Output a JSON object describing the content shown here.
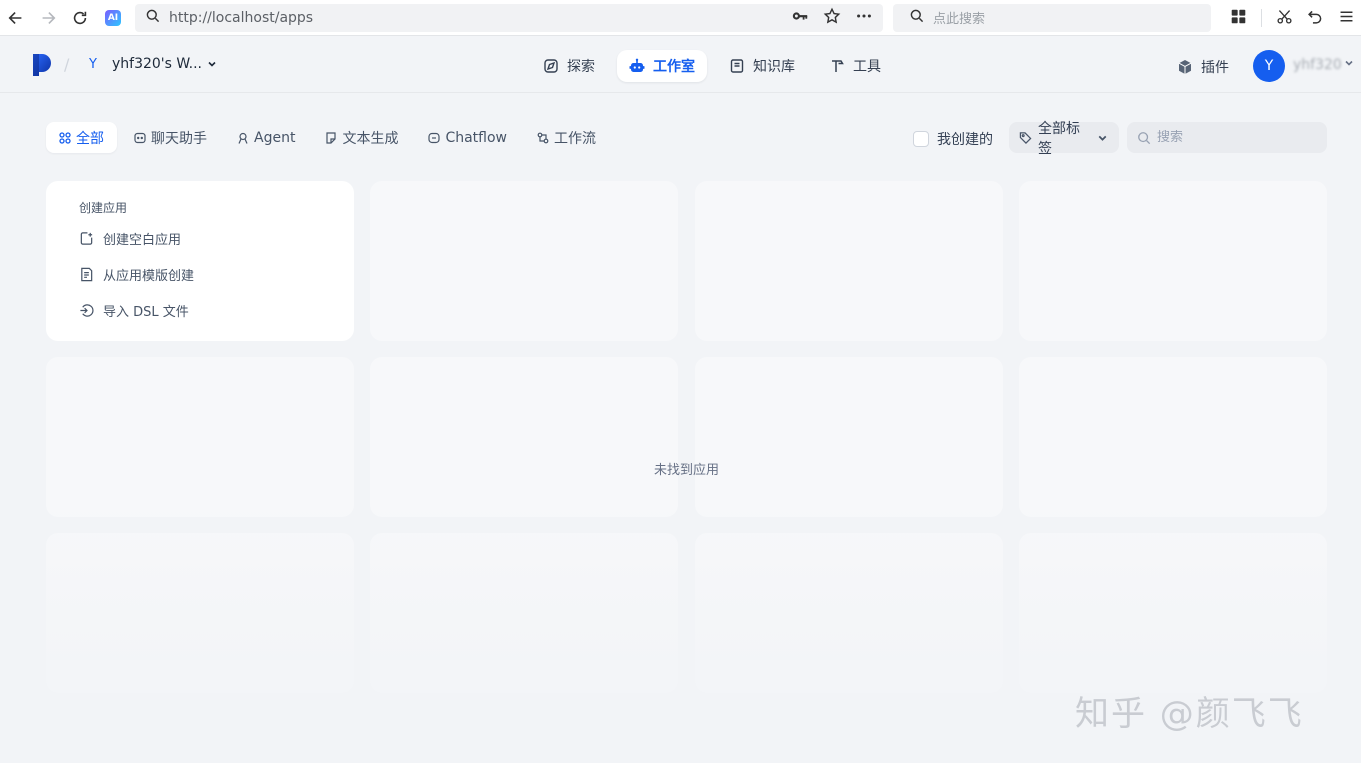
{
  "browser": {
    "url": "http://localhost/apps",
    "search_placeholder": "点此搜索",
    "ai_label": "AI"
  },
  "header": {
    "workspace_avatar": "Y",
    "workspace_name": "yhf320's W...",
    "nav": [
      {
        "label": "探索",
        "icon": "compass-icon",
        "active": false
      },
      {
        "label": "工作室",
        "icon": "robot-icon",
        "active": true
      },
      {
        "label": "知识库",
        "icon": "book-icon",
        "active": false
      },
      {
        "label": "工具",
        "icon": "hammer-icon",
        "active": false
      }
    ],
    "plugin_label": "插件",
    "user_avatar": "Y",
    "user_name": "yhf320"
  },
  "filters": {
    "tabs": [
      {
        "label": "全部",
        "icon": "grid-icon",
        "active": true
      },
      {
        "label": "聊天助手",
        "icon": "chat-icon",
        "active": false
      },
      {
        "label": "Agent",
        "icon": "agent-icon",
        "active": false
      },
      {
        "label": "文本生成",
        "icon": "document-icon",
        "active": false
      },
      {
        "label": "Chatflow",
        "icon": "chatflow-icon",
        "active": false
      },
      {
        "label": "工作流",
        "icon": "workflow-icon",
        "active": false
      }
    ],
    "my_created_label": "我创建的",
    "tag_label": "全部标签",
    "search_placeholder": "搜索"
  },
  "create": {
    "title": "创建应用",
    "items": [
      {
        "label": "创建空白应用",
        "icon": "new-file-icon"
      },
      {
        "label": "从应用模版创建",
        "icon": "template-icon"
      },
      {
        "label": "导入 DSL 文件",
        "icon": "import-icon"
      }
    ]
  },
  "empty_message": "未找到应用",
  "watermark": "知乎 @颜飞飞",
  "colors": {
    "accent": "#155eef",
    "background": "#f2f4f7"
  }
}
